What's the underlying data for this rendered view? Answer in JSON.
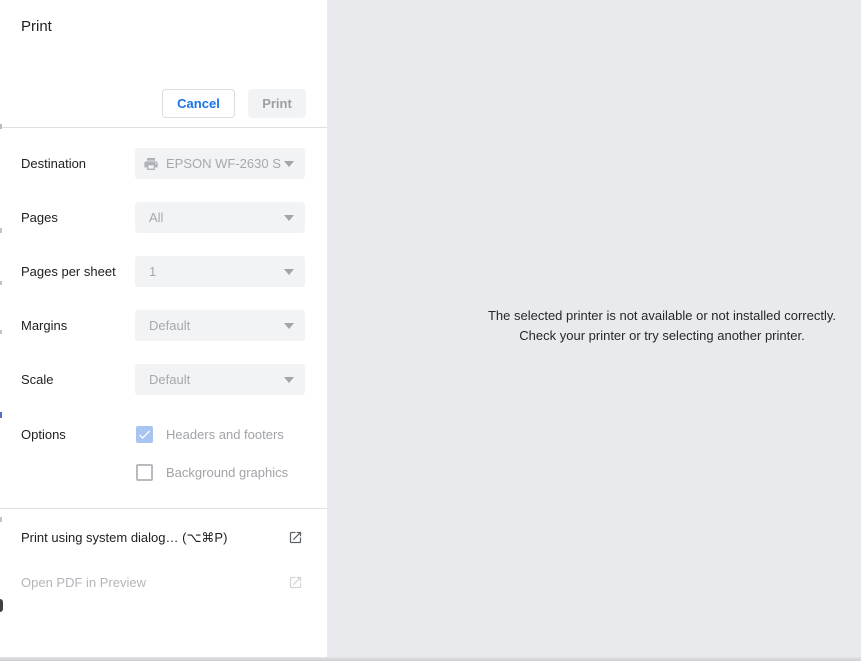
{
  "dialog": {
    "title": "Print",
    "cancel_label": "Cancel",
    "print_label": "Print",
    "fields": [
      {
        "label": "Destination",
        "value": "EPSON WF-2630 S",
        "icon": "printer-icon"
      },
      {
        "label": "Pages",
        "value": "All"
      },
      {
        "label": "Pages per sheet",
        "value": "1"
      },
      {
        "label": "Margins",
        "value": "Default"
      },
      {
        "label": "Scale",
        "value": "Default"
      }
    ],
    "options_label": "Options",
    "checkboxes": [
      {
        "label": "Headers and footers",
        "checked": true
      },
      {
        "label": "Background graphics",
        "checked": false
      }
    ],
    "system_dialog_label": "Print using system dialog… (⌥⌘P)",
    "open_pdf_label": "Open PDF in Preview"
  },
  "preview": {
    "message_line1": "The selected printer is not available or not installed correctly.",
    "message_line2": "Check your printer or try selecting another printer."
  },
  "colors": {
    "accent_blue": "#1a73e8",
    "preview_background": "#e8eaed",
    "control_background": "#f1f3f4",
    "disabled_text": "#a6a9ad",
    "checkbox_checked_fill": "#aac4f2"
  }
}
